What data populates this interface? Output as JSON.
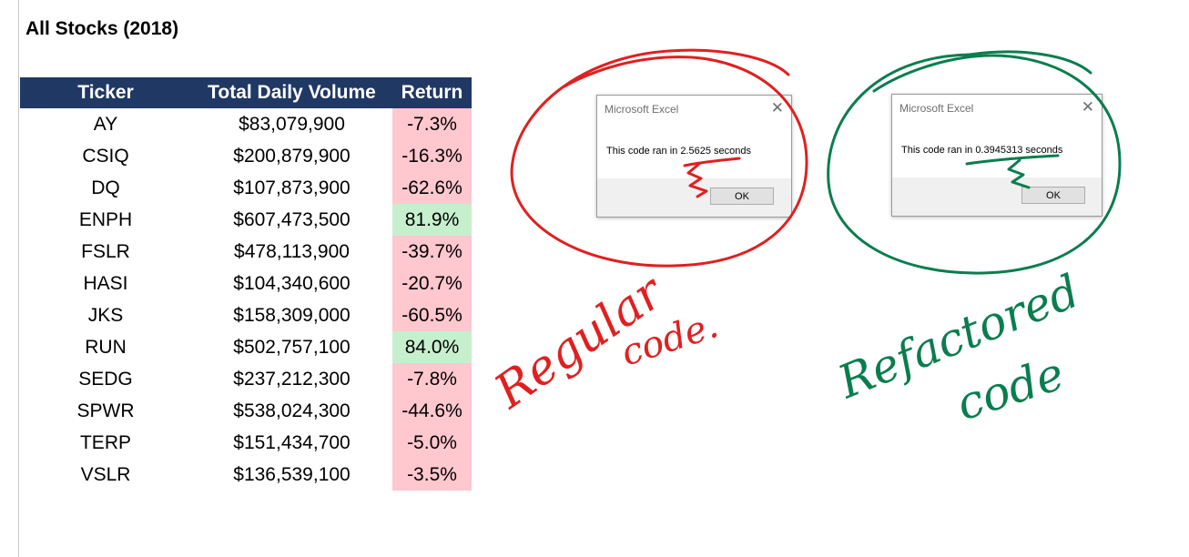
{
  "sheet_title": "All Stocks (2018)",
  "table": {
    "headers": [
      "Ticker",
      "Total Daily Volume",
      "Return"
    ],
    "rows": [
      {
        "ticker": "AY",
        "volume": "$83,079,900",
        "return": "-7.3%",
        "status": "negative"
      },
      {
        "ticker": "CSIQ",
        "volume": "$200,879,900",
        "return": "-16.3%",
        "status": "negative"
      },
      {
        "ticker": "DQ",
        "volume": "$107,873,900",
        "return": "-62.6%",
        "status": "negative"
      },
      {
        "ticker": "ENPH",
        "volume": "$607,473,500",
        "return": "81.9%",
        "status": "positive"
      },
      {
        "ticker": "FSLR",
        "volume": "$478,113,900",
        "return": "-39.7%",
        "status": "negative"
      },
      {
        "ticker": "HASI",
        "volume": "$104,340,600",
        "return": "-20.7%",
        "status": "negative"
      },
      {
        "ticker": "JKS",
        "volume": "$158,309,000",
        "return": "-60.5%",
        "status": "negative"
      },
      {
        "ticker": "RUN",
        "volume": "$502,757,100",
        "return": "84.0%",
        "status": "positive"
      },
      {
        "ticker": "SEDG",
        "volume": "$237,212,300",
        "return": "-7.8%",
        "status": "negative"
      },
      {
        "ticker": "SPWR",
        "volume": "$538,024,300",
        "return": "-44.6%",
        "status": "negative"
      },
      {
        "ticker": "TERP",
        "volume": "$151,434,700",
        "return": "-5.0%",
        "status": "negative"
      },
      {
        "ticker": "VSLR",
        "volume": "$136,539,100",
        "return": "-3.5%",
        "status": "negative"
      }
    ]
  },
  "colors": {
    "header_bg": "#203864",
    "negative_fill": "#ffc7ce",
    "positive_fill": "#c6efce",
    "regular_ink": "#e02020",
    "refactored_ink": "#0a7d4f"
  },
  "dialogs": {
    "regular": {
      "title": "Microsoft Excel",
      "message": "This code ran in 2.5625 seconds",
      "ok_label": "OK",
      "close_icon": "close-icon"
    },
    "refactored": {
      "title": "Microsoft Excel",
      "message": "This code ran in 0.3945313 seconds",
      "ok_label": "OK",
      "close_icon": "close-icon"
    }
  },
  "annotations": {
    "regular_line1": "Regular",
    "regular_line2": "code.",
    "refactored_line1": "Refactored",
    "refactored_line2": "code"
  }
}
